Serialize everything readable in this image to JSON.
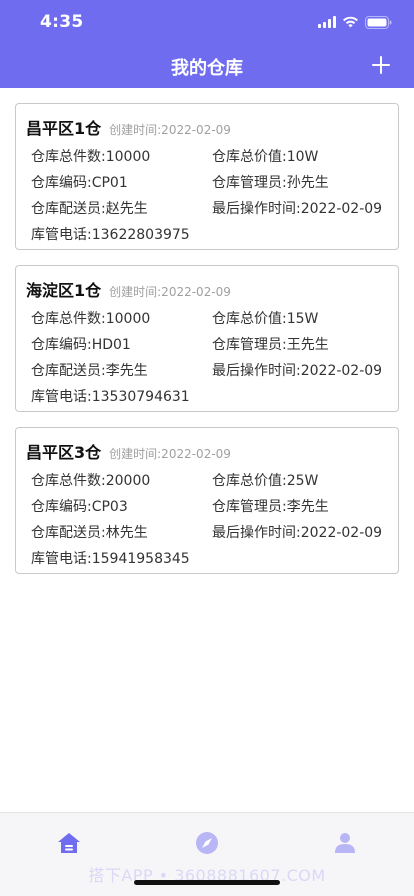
{
  "status_bar": {
    "time": "4:35"
  },
  "header": {
    "title": "我的仓库",
    "add_icon": "plus-icon"
  },
  "colors": {
    "accent": "#6f6cf0",
    "tab_icon": "#6f6cf0",
    "tab_icon_inactive": "#b9b6f5"
  },
  "warehouses": [
    {
      "name": "昌平区1仓",
      "created": "创建时间:2022-02-09",
      "total_items": "仓库总件数:10000",
      "total_value": "仓库总价值:10W",
      "code": "仓库编码:CP01",
      "manager": "仓库管理员:孙先生",
      "courier": "仓库配送员:赵先生",
      "last_op": "最后操作时间:2022-02-09",
      "phone": "库管电话:13622803975"
    },
    {
      "name": "海淀区1仓",
      "created": "创建时间:2022-02-09",
      "total_items": "仓库总件数:10000",
      "total_value": "仓库总价值:15W",
      "code": "仓库编码:HD01",
      "manager": "仓库管理员:王先生",
      "courier": "仓库配送员:李先生",
      "last_op": "最后操作时间:2022-02-09",
      "phone": "库管电话:13530794631"
    },
    {
      "name": "昌平区3仓",
      "created": "创建时间:2022-02-09",
      "total_items": "仓库总件数:20000",
      "total_value": "仓库总价值:25W",
      "code": "仓库编码:CP03",
      "manager": "仓库管理员:李先生",
      "courier": "仓库配送员:林先生",
      "last_op": "最后操作时间:2022-02-09",
      "phone": "库管电话:15941958345"
    }
  ],
  "tabbar": {
    "items": [
      "home-icon",
      "compass-icon",
      "profile-icon"
    ]
  },
  "watermark": "搭下APP • 3608881607.COM"
}
